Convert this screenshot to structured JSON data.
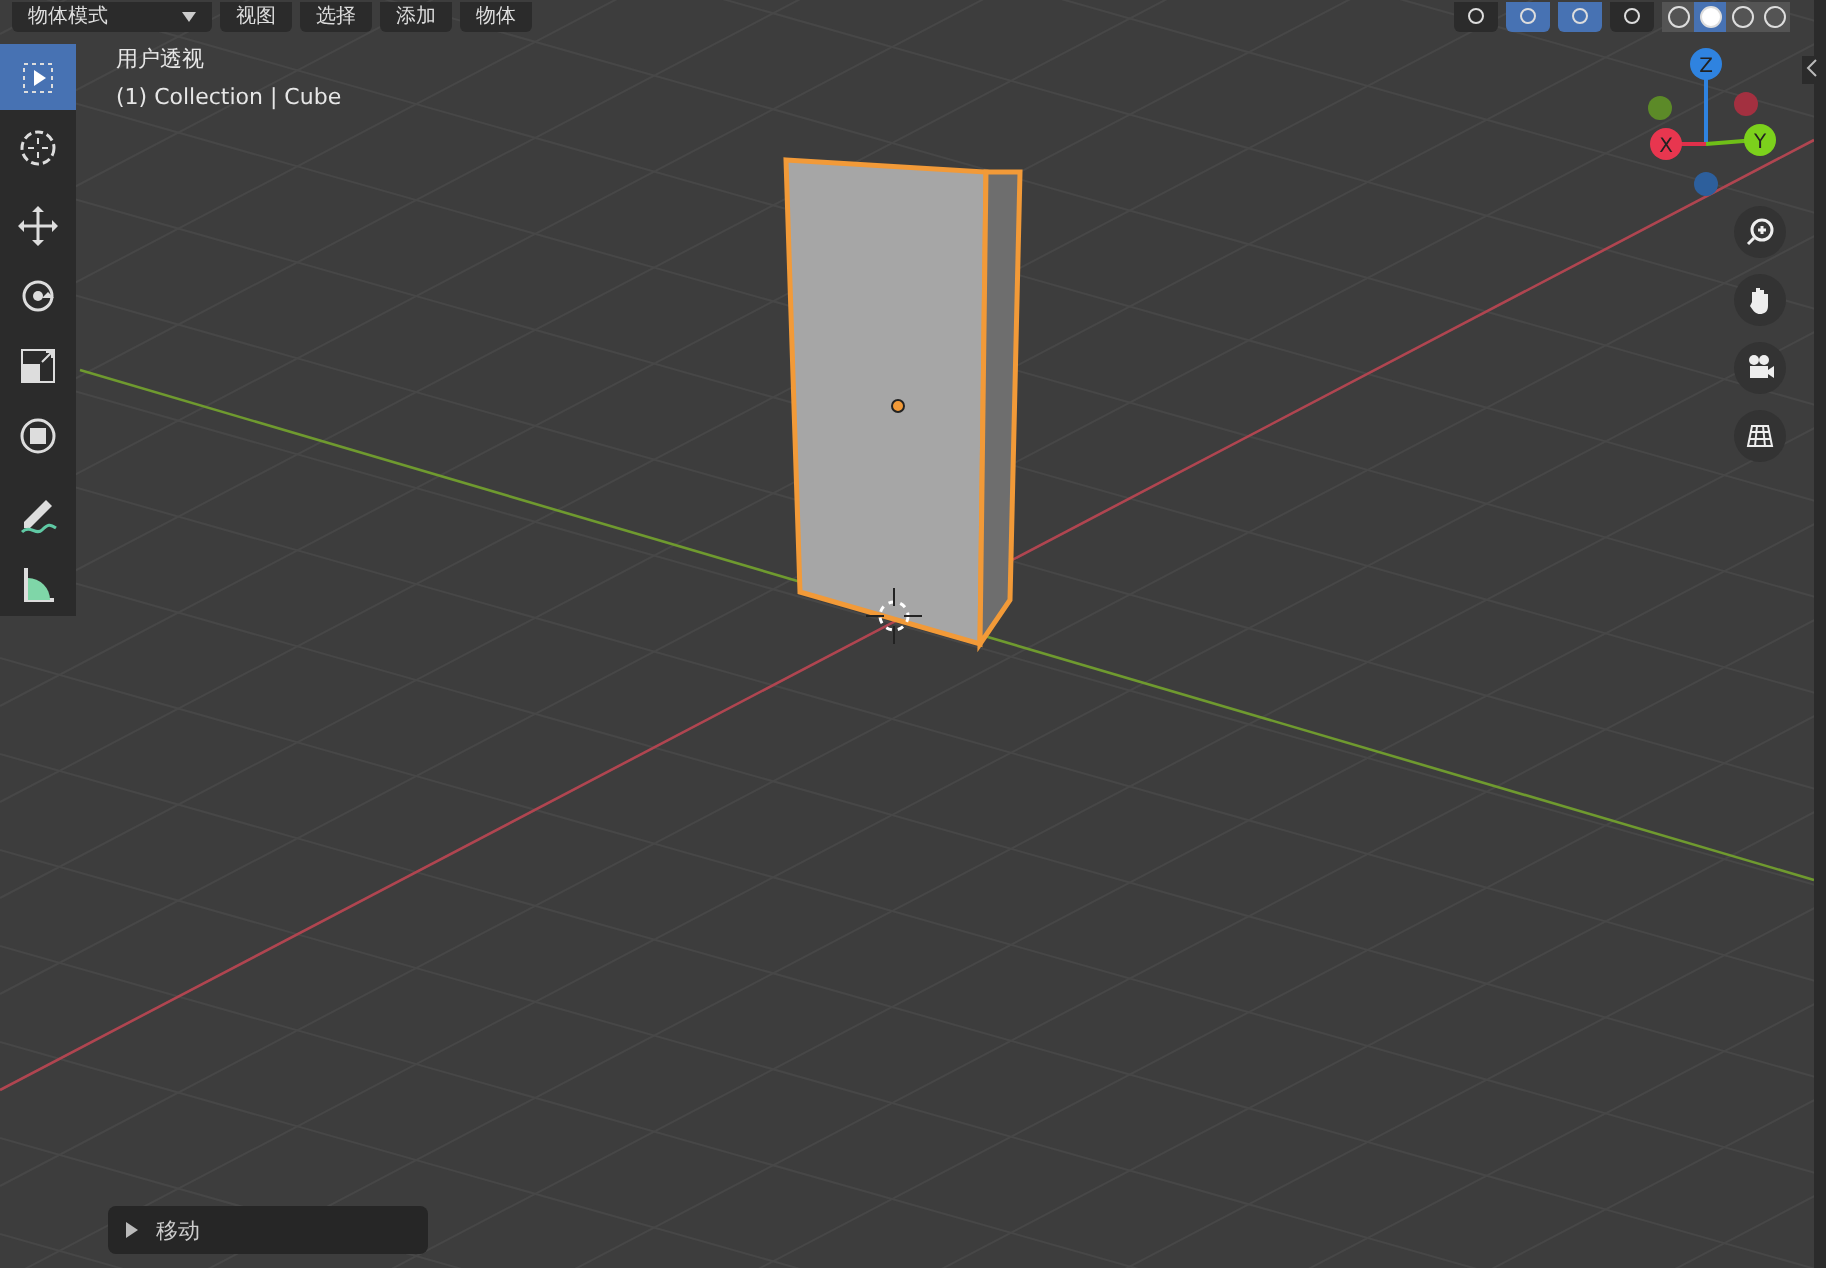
{
  "header": {
    "mode_menu": "物体模式",
    "menus": [
      "视图",
      "选择",
      "添加",
      "物体"
    ],
    "toggles": [
      {
        "on": false
      },
      {
        "on": true
      },
      {
        "on": true
      },
      {
        "on": false
      }
    ],
    "shading": [
      {
        "selected": false
      },
      {
        "selected": true
      },
      {
        "selected": false
      },
      {
        "selected": false
      }
    ]
  },
  "viewport": {
    "view_name": "用户透视",
    "object_info": "(1) Collection | Cube"
  },
  "tools": [
    {
      "selected": true
    },
    {
      "selected": false
    },
    {
      "selected": false
    },
    {
      "selected": false
    },
    {
      "selected": false
    },
    {
      "selected": false
    },
    {
      "selected": false
    },
    {
      "selected": false
    }
  ],
  "gizmo": {
    "labels": [
      "X",
      "Y",
      "Z"
    ]
  },
  "operator_panel": {
    "title": "移动",
    "expanded": false
  }
}
